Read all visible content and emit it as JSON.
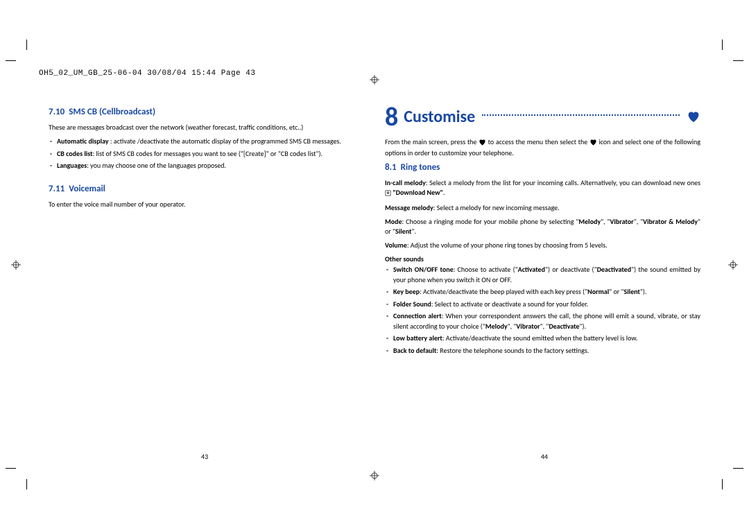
{
  "header_meta": "OH5_02_UM_GB_25-06-04  30/08/04  15:44  Page 43",
  "leftPage": {
    "section1": {
      "num": "7.10",
      "title": "SMS CB (Cellbroadcast)"
    },
    "intro1": "These are messages broadcast over the network (weather forecast, traffic conditions, etc..)",
    "bullets1": {
      "b0_bold": "Automatic display",
      "b0_rest": " : activate /deactivate the automatic display of the programmed SMS CB messages.",
      "b1_bold": "CB codes list",
      "b1_rest": ": list of SMS CB codes for messages you want to see (\"[Create]\" or \"CB codes list\").",
      "b2_bold": "Languages",
      "b2_rest": ": you may choose one of the languages proposed."
    },
    "section2": {
      "num": "7.11",
      "title": "Voicemail"
    },
    "voicemail_text": "To enter the voice mail number of your operator.",
    "pageNumber": "43"
  },
  "rightPage": {
    "chapter": {
      "num": "8",
      "title": "Customise"
    },
    "intro_a": "From the main screen, press the ",
    "intro_b": " to access the menu then select the ",
    "intro_c": " icon and select one of the following options in order to customize your telephone.",
    "section1": {
      "num": "8.1",
      "title": "Ring tones"
    },
    "ring": {
      "incall_bold": "In-call melody",
      "incall_rest": ": Select a melody from the list for your incoming calls. Alternatively, you can download new ones ",
      "incall_dl": "\"Download New\"",
      "msg_bold": "Message melody",
      "msg_rest": ": Select a melody for new incoming message.",
      "mode_bold": "Mode",
      "mode_rest_a": ": Choose a ringing mode for your mobile phone by selecting \"",
      "mode_m": "Melody",
      "mode_rest_b": "\", \"",
      "mode_v": "Vibrator",
      "mode_rest_c": "\", \"",
      "mode_vm": "Vibrator & Melody",
      "mode_rest_d": "\" or \"",
      "mode_s": "Silent",
      "mode_rest_e": "\".",
      "vol_bold": "Volume",
      "vol_rest": ": Adjust the volume of your phone ring tones by choosing from 5 levels.",
      "other_sounds": "Other sounds"
    },
    "sounds": {
      "s0_bold": "Switch ON/OFF tone",
      "s0_rest_a": ": Choose to activate (\"",
      "s0_act": "Activated",
      "s0_rest_b": "\") or deactivate (\"",
      "s0_deact": "Deactivated",
      "s0_rest_c": "\") the sound emitted by your phone when you switch it ON or OFF.",
      "s1_bold": "Key beep",
      "s1_rest_a": ": Activate/deactivate the beep played with each key press (\"",
      "s1_norm": "Normal",
      "s1_rest_b": "\" or \"",
      "s1_sil": "Silent",
      "s1_rest_c": "\").",
      "s2_bold": "Folder Sound",
      "s2_rest": ": Select to activate or deactivate a sound for your folder.",
      "s3_bold": "Connection alert",
      "s3_rest_a": ": When your correspondent answers the call, the phone will emit a sound, vibrate, or stay silent according to your choice (\"",
      "s3_m": "Melody",
      "s3_rest_b": "\", \"",
      "s3_v": "Vibrator",
      "s3_rest_c": "\", \"",
      "s3_d": "Deactivate",
      "s3_rest_d": "\").",
      "s4_bold": "Low battery alert",
      "s4_rest": ": Activate/deactivate the sound emitted when the battery level is low.",
      "s5_bold": "Back to default",
      "s5_rest": ": Restore the telephone sounds to the factory settings."
    },
    "pageNumber": "44"
  }
}
